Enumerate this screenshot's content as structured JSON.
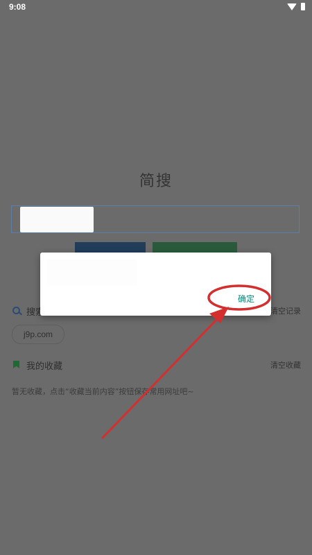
{
  "status_bar": {
    "time": "9:08"
  },
  "app": {
    "title": "简搜"
  },
  "search": {
    "value": "",
    "placeholder": ""
  },
  "history": {
    "label": "搜索",
    "clear_label": "清空记录",
    "items": [
      "j9p.com"
    ]
  },
  "favorites": {
    "label": "我的收藏",
    "clear_label": "清空收藏",
    "empty_tip": "暂无收藏，点击“收藏当前内容”按钮保存常用网址吧~"
  },
  "dialog": {
    "message": "",
    "ok_label": "确定"
  },
  "colors": {
    "overlay": "#6b6b6b",
    "accent_teal": "#00897b",
    "annotation_red": "#d32f2f",
    "blue_button": "#223d5a",
    "green_button": "#2a5a3c"
  },
  "icons": [
    "wifi-icon",
    "battery-icon",
    "search-icon",
    "bookmark-icon"
  ]
}
